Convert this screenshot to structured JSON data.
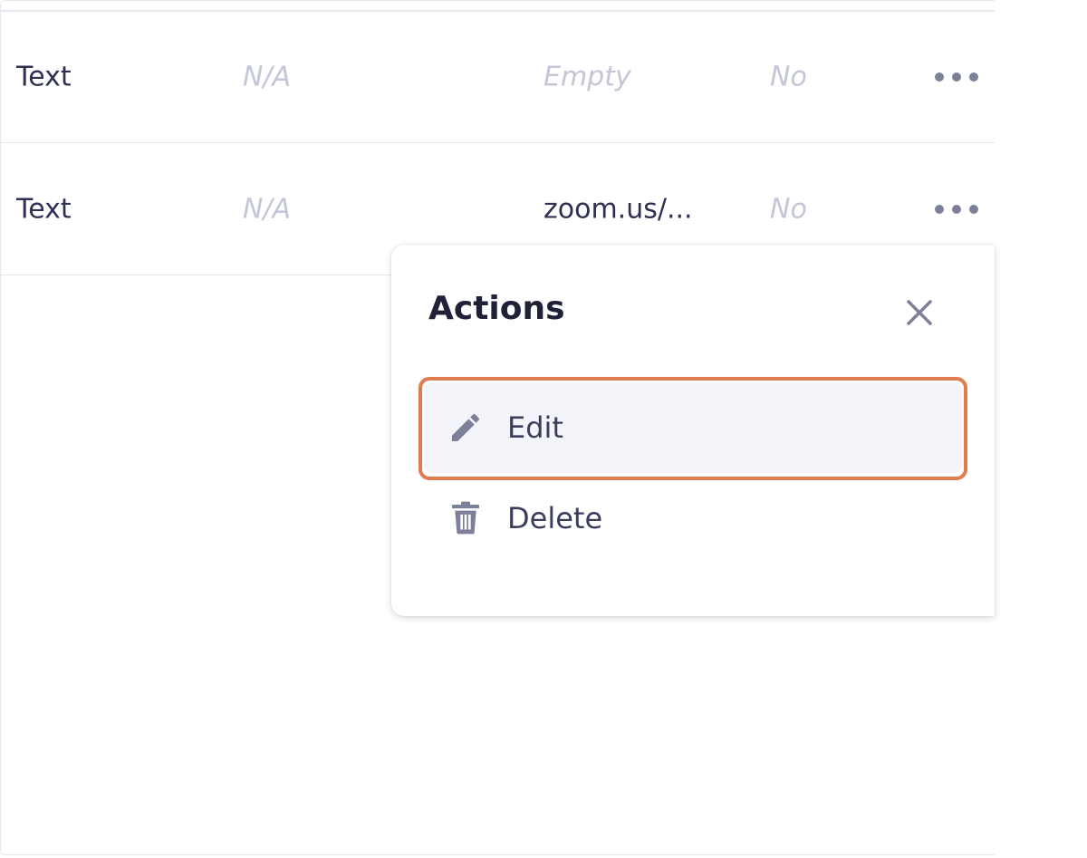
{
  "table": {
    "rows": [
      {
        "type": "Text",
        "default": "N/A",
        "value": "Empty",
        "value_is_placeholder": true,
        "required": "No",
        "more_icon": "more-horizontal-icon"
      },
      {
        "type": "Text",
        "default": "N/A",
        "value": "zoom.us/...",
        "value_is_placeholder": false,
        "required": "No",
        "more_icon": "more-horizontal-icon"
      }
    ]
  },
  "actions_menu": {
    "title": "Actions",
    "close_icon": "close-icon",
    "items": [
      {
        "label": "Edit",
        "icon": "pencil-icon"
      },
      {
        "label": "Delete",
        "icon": "trash-icon"
      }
    ]
  },
  "colors": {
    "highlight": "#e07c4f",
    "hover_bg": "#f3f4f9",
    "muted_text": "#c3c6d6",
    "icon": "#7d8099"
  }
}
